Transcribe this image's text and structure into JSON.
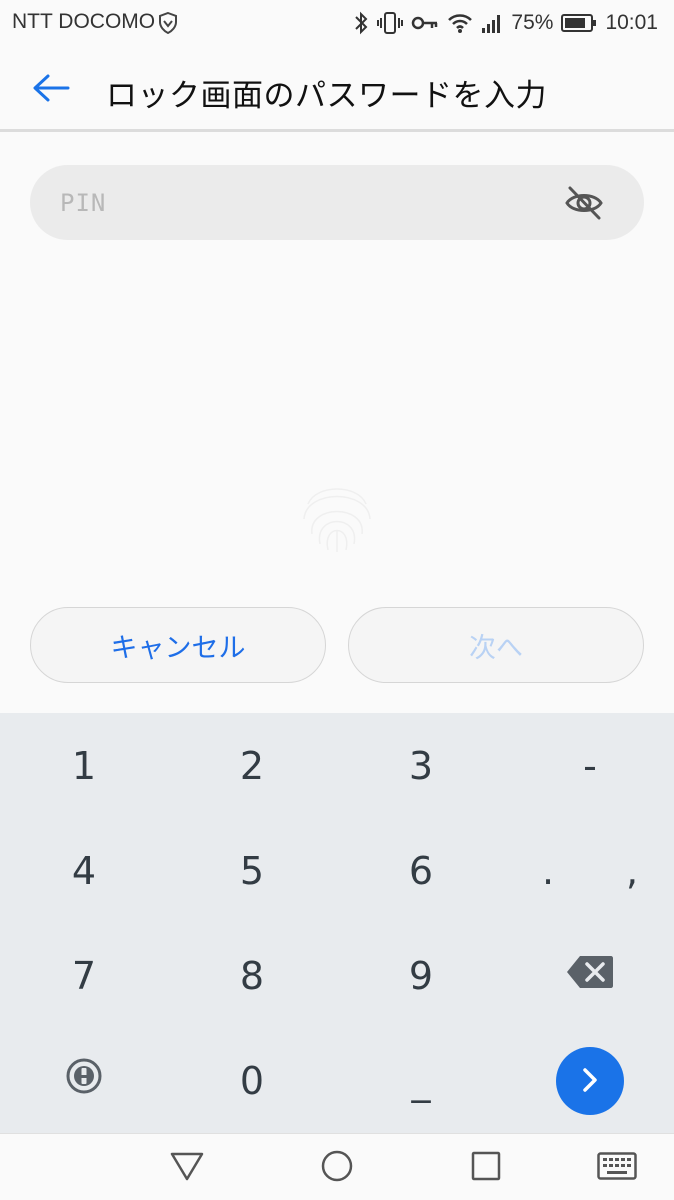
{
  "status_bar": {
    "carrier": "NTT DOCOMO",
    "battery_percent": "75%",
    "time": "10:01"
  },
  "header": {
    "title": "ロック画面のパスワードを入力"
  },
  "pin_field": {
    "placeholder": "PIN",
    "value": ""
  },
  "actions": {
    "cancel_label": "キャンセル",
    "next_label": "次へ"
  },
  "keyboard": {
    "keys": [
      "1",
      "2",
      "3",
      "-",
      "4",
      "5",
      "6",
      ".",
      ",",
      "7",
      "8",
      "9",
      "0",
      "_"
    ]
  },
  "colors": {
    "accent": "#1a73e8",
    "next_disabled": "#b9d2f4",
    "keyboard_bg": "#e8ebee"
  }
}
